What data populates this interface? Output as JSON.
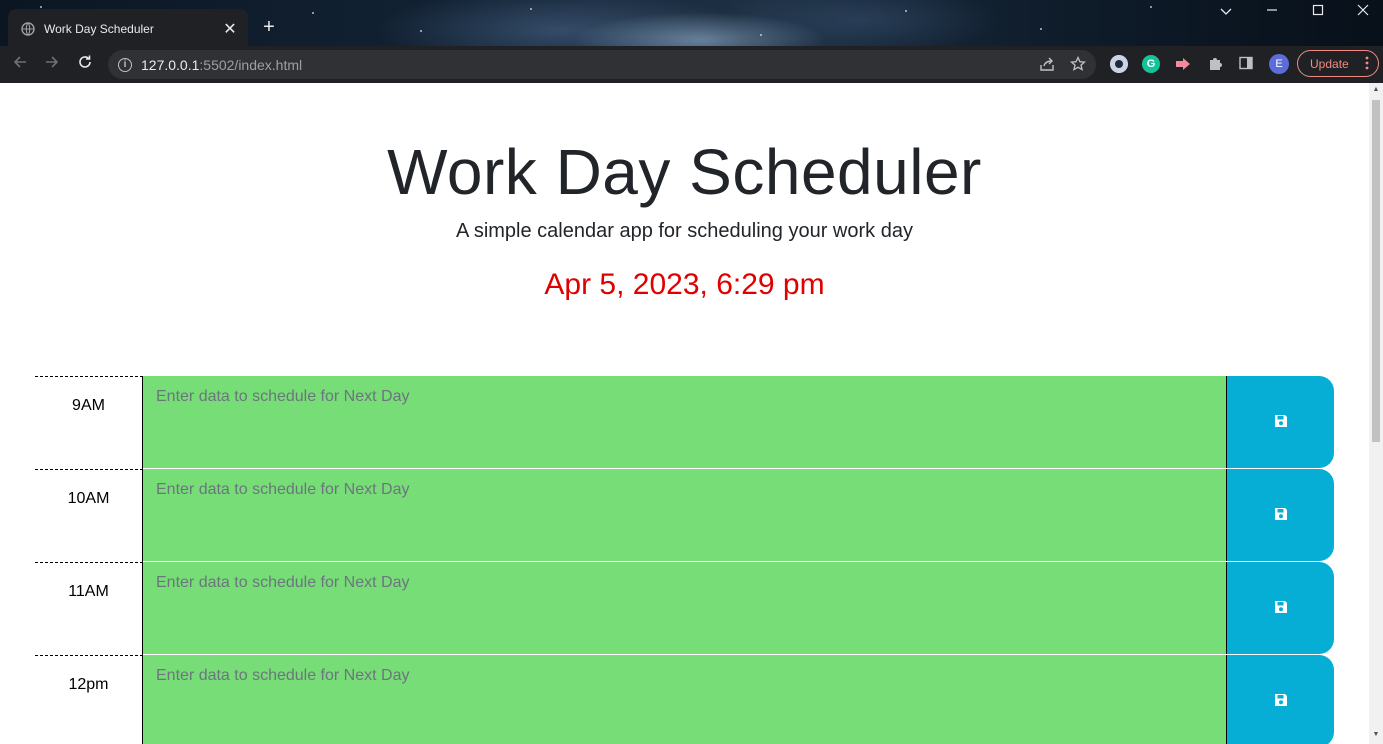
{
  "browser": {
    "tab_title": "Work Day Scheduler",
    "tab_close": "✕",
    "new_tab": "+",
    "url_host": "127.0.0.1",
    "url_rest": ":5502/index.html",
    "update_label": "Update",
    "icons": {
      "back": "arrow-left-icon",
      "forward": "arrow-right-icon",
      "reload": "reload-icon",
      "share": "share-icon",
      "bookmark": "star-icon",
      "extensions": "puzzle-icon",
      "side_panel": "side-panel-icon",
      "profile": "E",
      "menu": "kebab-menu-icon"
    },
    "accent_colors": {
      "update": "#f28b82",
      "profile": "#5b6dd9",
      "grammarly": "#15c39a"
    }
  },
  "header": {
    "title": "Work Day Scheduler",
    "lead": "A simple calendar app for scheduling your work day",
    "current_day": "Apr 5, 2023, 6:29 pm",
    "current_day_color": "#e00000"
  },
  "schedule": {
    "future_color": "#77dd77",
    "save_color": "#06aed5",
    "rows": [
      {
        "hour": "9AM",
        "value": "",
        "placeholder": "Enter data to schedule for Next Day"
      },
      {
        "hour": "10AM",
        "value": "",
        "placeholder": "Enter data to schedule for Next Day"
      },
      {
        "hour": "11AM",
        "value": "",
        "placeholder": "Enter data to schedule for Next Day"
      },
      {
        "hour": "12pm",
        "value": "",
        "placeholder": "Enter data to schedule for Next Day"
      }
    ]
  }
}
